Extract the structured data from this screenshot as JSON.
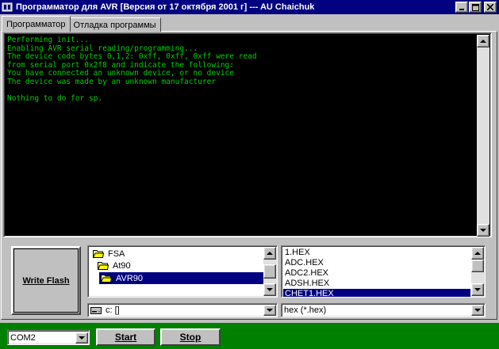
{
  "window": {
    "title": "Программатор для AVR [Версия от 17 октября 2001 г] --- AU Chaichuk",
    "controls": {
      "minimize": "_",
      "maximize": "□",
      "close": "×"
    }
  },
  "tabs": [
    {
      "label": "Программатор",
      "active": true
    },
    {
      "label": "Отладка программы",
      "active": false
    }
  ],
  "console": {
    "lines": [
      "Performing init...",
      "Enabling AVR serial reading/programming...",
      "The device code bytes 0,1,2: 0xff, 0xff, 0xff were read",
      "from serial port 0x2f8 and indicate the following:",
      "You have connected an unknown device, or no device",
      "The device was made by an unknown manufacturer",
      "",
      "Nothing to do for sp."
    ],
    "text_color": "#00d000",
    "background": "#000000"
  },
  "buttons": {
    "write_flash": "Write Flash",
    "start": "Start",
    "stop": "Stop"
  },
  "folders": [
    {
      "name": "FSA",
      "level": 0,
      "open": true,
      "selected": false
    },
    {
      "name": "At90",
      "level": 1,
      "open": true,
      "selected": false
    },
    {
      "name": "AVR90",
      "level": 2,
      "open": true,
      "selected": true
    }
  ],
  "files": [
    "1.HEX",
    "ADC.HEX",
    "ADC2.HEX",
    "ADSH.HEX",
    "CHET1.HEX"
  ],
  "selected_file": "CHET1.HEX",
  "drive_select": {
    "value": "c: []"
  },
  "filter_select": {
    "value": "hex (*.hex)"
  },
  "port_select": {
    "value": "COM2"
  },
  "colors": {
    "titlebar": "#000080",
    "selection": "#000080",
    "bottom_bar": "#008000",
    "face": "#c0c0c0"
  },
  "icons": {
    "app": "app-icon",
    "folder": "folder-open-icon",
    "drive": "drive-icon"
  }
}
